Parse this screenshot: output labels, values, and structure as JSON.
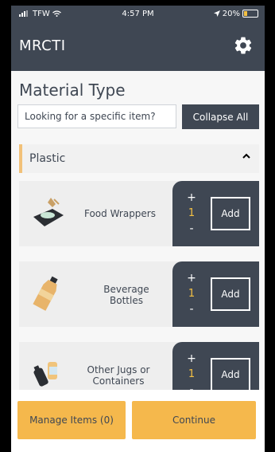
{
  "status": {
    "carrier": "TFW",
    "time": "4:57 PM",
    "battery": "20%"
  },
  "header": {
    "title": "MRCTI"
  },
  "main": {
    "title": "Material Type",
    "search_placeholder": "Looking for a specific item?",
    "collapse_label": "Collapse All",
    "category": {
      "name": "Plastic"
    },
    "items": [
      {
        "label_line1": "Food Wrappers",
        "label_line2": "",
        "qty": "1",
        "add_label": "Add",
        "plus": "+",
        "minus": "-"
      },
      {
        "label_line1": "Beverage",
        "label_line2": "Bottles",
        "qty": "1",
        "add_label": "Add",
        "plus": "+",
        "minus": "-"
      },
      {
        "label_line1": "Other Jugs or",
        "label_line2": "Containers",
        "qty": "1",
        "add_label": "Add",
        "plus": "+",
        "minus": "-"
      }
    ]
  },
  "footer": {
    "manage_label": "Manage Items (0)",
    "continue_label": "Continue"
  },
  "colors": {
    "primary": "#3f4753",
    "accent": "#f5b84c",
    "quantity": "#f4c143"
  }
}
